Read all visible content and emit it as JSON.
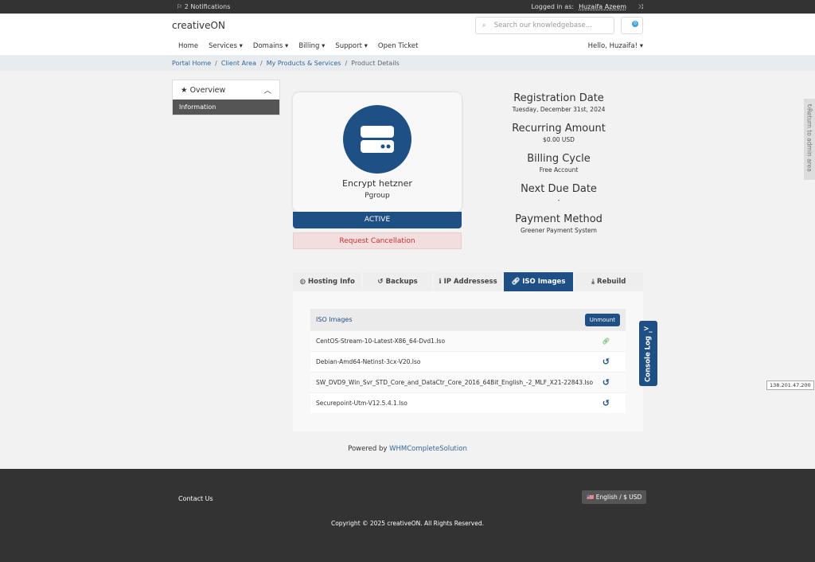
{
  "topbar": {
    "notifications": "2 Notifications",
    "logged_in_label": "Logged in as:",
    "user": "Huzaifa Azeem"
  },
  "header": {
    "brand": "creativeON",
    "search_placeholder": "Search our knowledgebase...",
    "cart_count": "0"
  },
  "nav": {
    "items": [
      "Home",
      "Services ▾",
      "Domains ▾",
      "Billing ▾",
      "Support ▾",
      "Open Ticket"
    ],
    "greeting": "Hello, Huzaifa! ▾"
  },
  "breadcrumb": [
    "Portal Home",
    "Client Area",
    "My Products & Services",
    "Product Details"
  ],
  "sidebar": {
    "title": "Overview",
    "item": "Information"
  },
  "product": {
    "name": "Encrypt hetzner",
    "group": "Pgroup",
    "status": "ACTIVE",
    "cancel": "Request Cancellation"
  },
  "info": [
    {
      "label": "Registration Date",
      "value": "Tuesday, December 31st, 2024"
    },
    {
      "label": "Recurring Amount",
      "value": "$0.00 USD"
    },
    {
      "label": "Billing Cycle",
      "value": "Free Account"
    },
    {
      "label": "Next Due Date",
      "value": "-"
    },
    {
      "label": "Payment Method",
      "value": "Greener Payment System"
    }
  ],
  "tabs": [
    {
      "label": "Hosting Info",
      "icon": "globe-icon"
    },
    {
      "label": "Backups",
      "icon": "undo-icon"
    },
    {
      "label": "IP Addressess",
      "icon": "info-icon"
    },
    {
      "label": "ISO Images",
      "icon": "link-icon",
      "active": true
    },
    {
      "label": "Rebuild",
      "icon": "download-icon"
    }
  ],
  "iso": {
    "header": "ISO Images",
    "unmount": "Unmount",
    "rows": [
      {
        "name": "CentOS-Stream-10-Latest-X86_64-Dvd1.Iso",
        "mounted": true
      },
      {
        "name": "Debian-Amd64-Netinst-3cx-V20.Iso",
        "mounted": false
      },
      {
        "name": "SW_DVD9_Win_Svr_STD_Core_and_DataCtr_Core_2016_64Bit_English_-2_MLF_X21-22843.Iso",
        "mounted": false
      },
      {
        "name": "Securepoint-Utm-V12.5.4.1.Iso",
        "mounted": false
      }
    ]
  },
  "console_log": "Console Log",
  "admin_return": "Return to admin area",
  "ip": "138.201.47.200",
  "powered": {
    "prefix": "Powered by",
    "link": "WHMCompleteSolution"
  },
  "footer": {
    "contact": "Contact Us",
    "language": "English / $ USD",
    "copyright": "Copyright © 2025 creativeON. All Rights Reserved."
  },
  "colors": {
    "primary": "#1e4f85",
    "mounted": "#2e9e2e",
    "danger_bg": "#f2dede"
  }
}
